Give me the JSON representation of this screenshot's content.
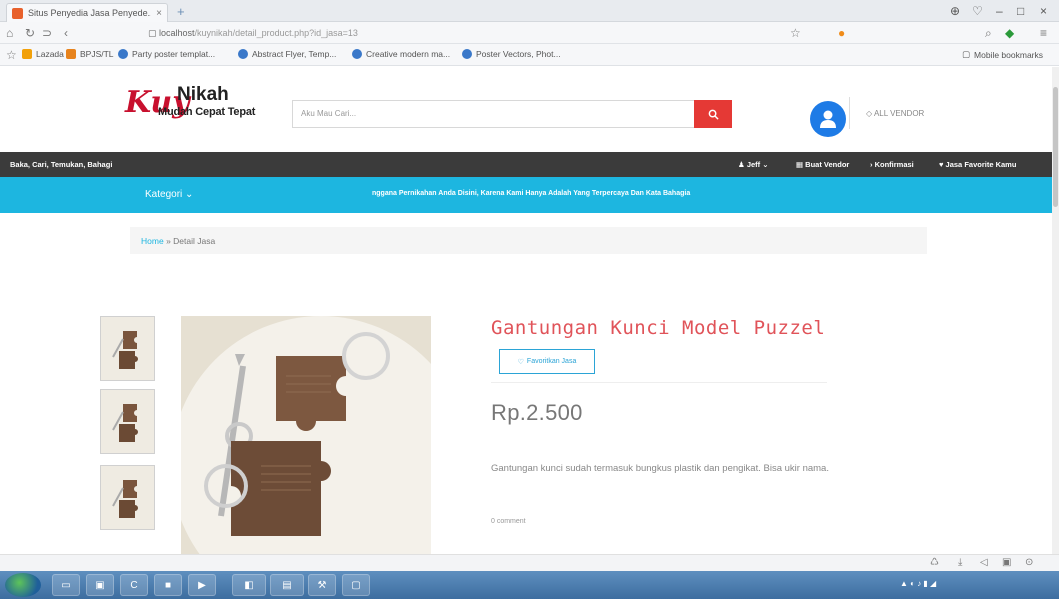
{
  "browser": {
    "tab_title": "Situs Penyedia Jasa Penyede...",
    "tab_close": "×",
    "new_tab": "+",
    "url_host": "localhost",
    "url_path": "/kuynikah/detail_product.php?id_jasa=13",
    "controls": [
      "–",
      "□",
      "×"
    ],
    "bookmarks": [
      "Lazada",
      "BPJS/TL",
      "Party poster templat...",
      "Abstract Flyer, Temp...",
      "Creative modern ma...",
      "Poster Vectors, Phot..."
    ],
    "mobile_bookmarks": "Mobile bookmarks"
  },
  "header": {
    "logo_script": "Kuy",
    "logo_word": "Nikah",
    "logo_tagline": "Mudah Cepat Tepat",
    "search_placeholder": "Aku Mau Cari...",
    "all_vendor": "ALL VENDOR"
  },
  "darkbar": {
    "left_text": "Baka, Cari, Temukan, Bahagi",
    "items": [
      "Jeff",
      "Buat Vendor",
      "Konfirmasi",
      "Jasa Favorite Kamu"
    ]
  },
  "cyanbar": {
    "kategori": "Kategori",
    "marquee": "nggana Pernikahan Anda Disini, Karena Kami Hanya Adalah Yang Terpercaya Dan Kata Bahagia"
  },
  "breadcrumb": {
    "home": "Home",
    "separator": "»",
    "current": "Detail Jasa"
  },
  "product": {
    "title": "Gantungan Kunci Model Puzzel",
    "favorite_label": "Favoritkan Jasa",
    "price": "Rp.2.500",
    "description": "Gantungan kunci sudah termasuk bungkus plastik dan pengikat. Bisa ukir nama.",
    "extra": "0 comment"
  },
  "colors": {
    "title_red": "#e05359",
    "cyan": "#1db6e0",
    "dark": "#3b3b3b",
    "search_red": "#e53935",
    "avatar_blue": "#1e7be6"
  }
}
